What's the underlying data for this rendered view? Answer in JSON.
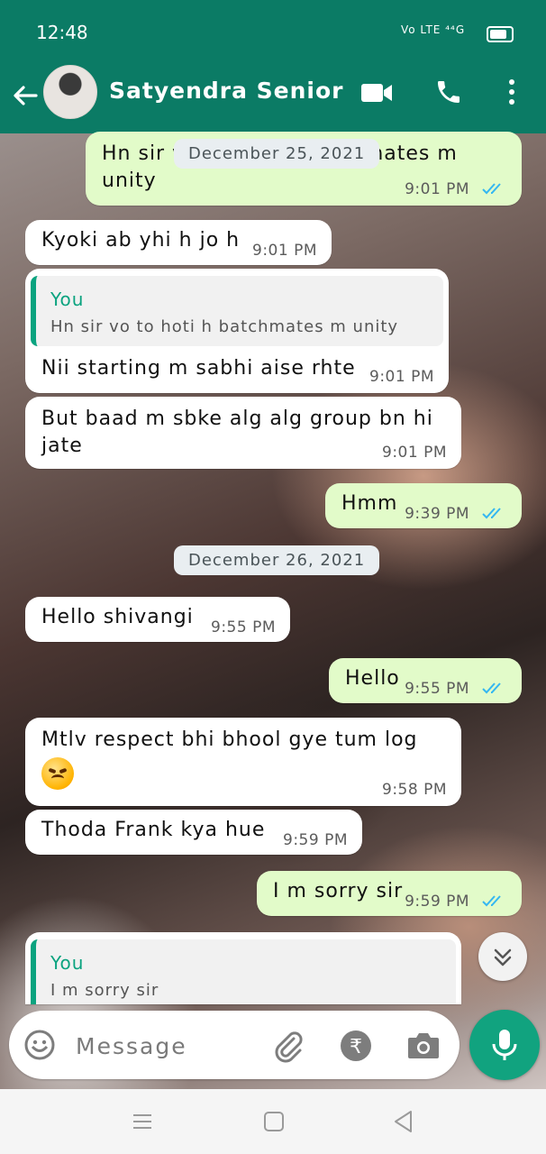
{
  "status_bar": {
    "time": "12:48",
    "network": "Vo LTE ⁴⁴G"
  },
  "header": {
    "contact_name": "Satyendra Senior"
  },
  "messages": [
    {
      "dir": "out",
      "text": "Hn sir vo to hoti h batchmates m unity",
      "time": "9:01 PM"
    },
    {
      "dir": "in",
      "text": "Kyoki ab yhi h jo h",
      "time": "9:01 PM"
    },
    {
      "dir": "in",
      "quote_author": "You",
      "quote_text": "Hn sir vo to hoti h batchmates m unity",
      "text": "Nii starting m sabhi aise rhte",
      "time": "9:01 PM"
    },
    {
      "dir": "in",
      "text": "But baad m sbke alg alg group bn hi jate",
      "time": "9:01 PM"
    },
    {
      "dir": "out",
      "text": "Hmm",
      "time": "9:39 PM"
    },
    {
      "dir": "in",
      "text": "Hello shivangi",
      "time": "9:55 PM"
    },
    {
      "dir": "out",
      "text": "Hello",
      "time": "9:55 PM"
    },
    {
      "dir": "in",
      "text": "Mtlv respect bhi bhool gye tum log",
      "emoji": "angry-face",
      "time": "9:58 PM"
    },
    {
      "dir": "in",
      "text": "Thoda Frank kya hue",
      "time": "9:59 PM"
    },
    {
      "dir": "out",
      "text": "I m sorry sir",
      "time": "9:59 PM"
    },
    {
      "dir": "in",
      "quote_author": "You",
      "quote_text": "I m sorry sir"
    }
  ],
  "dates": {
    "first": "December 25, 2021",
    "second": "December 26, 2021"
  },
  "composer": {
    "placeholder": "Message"
  },
  "colors": {
    "header": "#0b7b65",
    "accent": "#11a37f",
    "outgoing": "#e2fbc9",
    "incoming": "#ffffff",
    "tick": "#34b7f1"
  }
}
